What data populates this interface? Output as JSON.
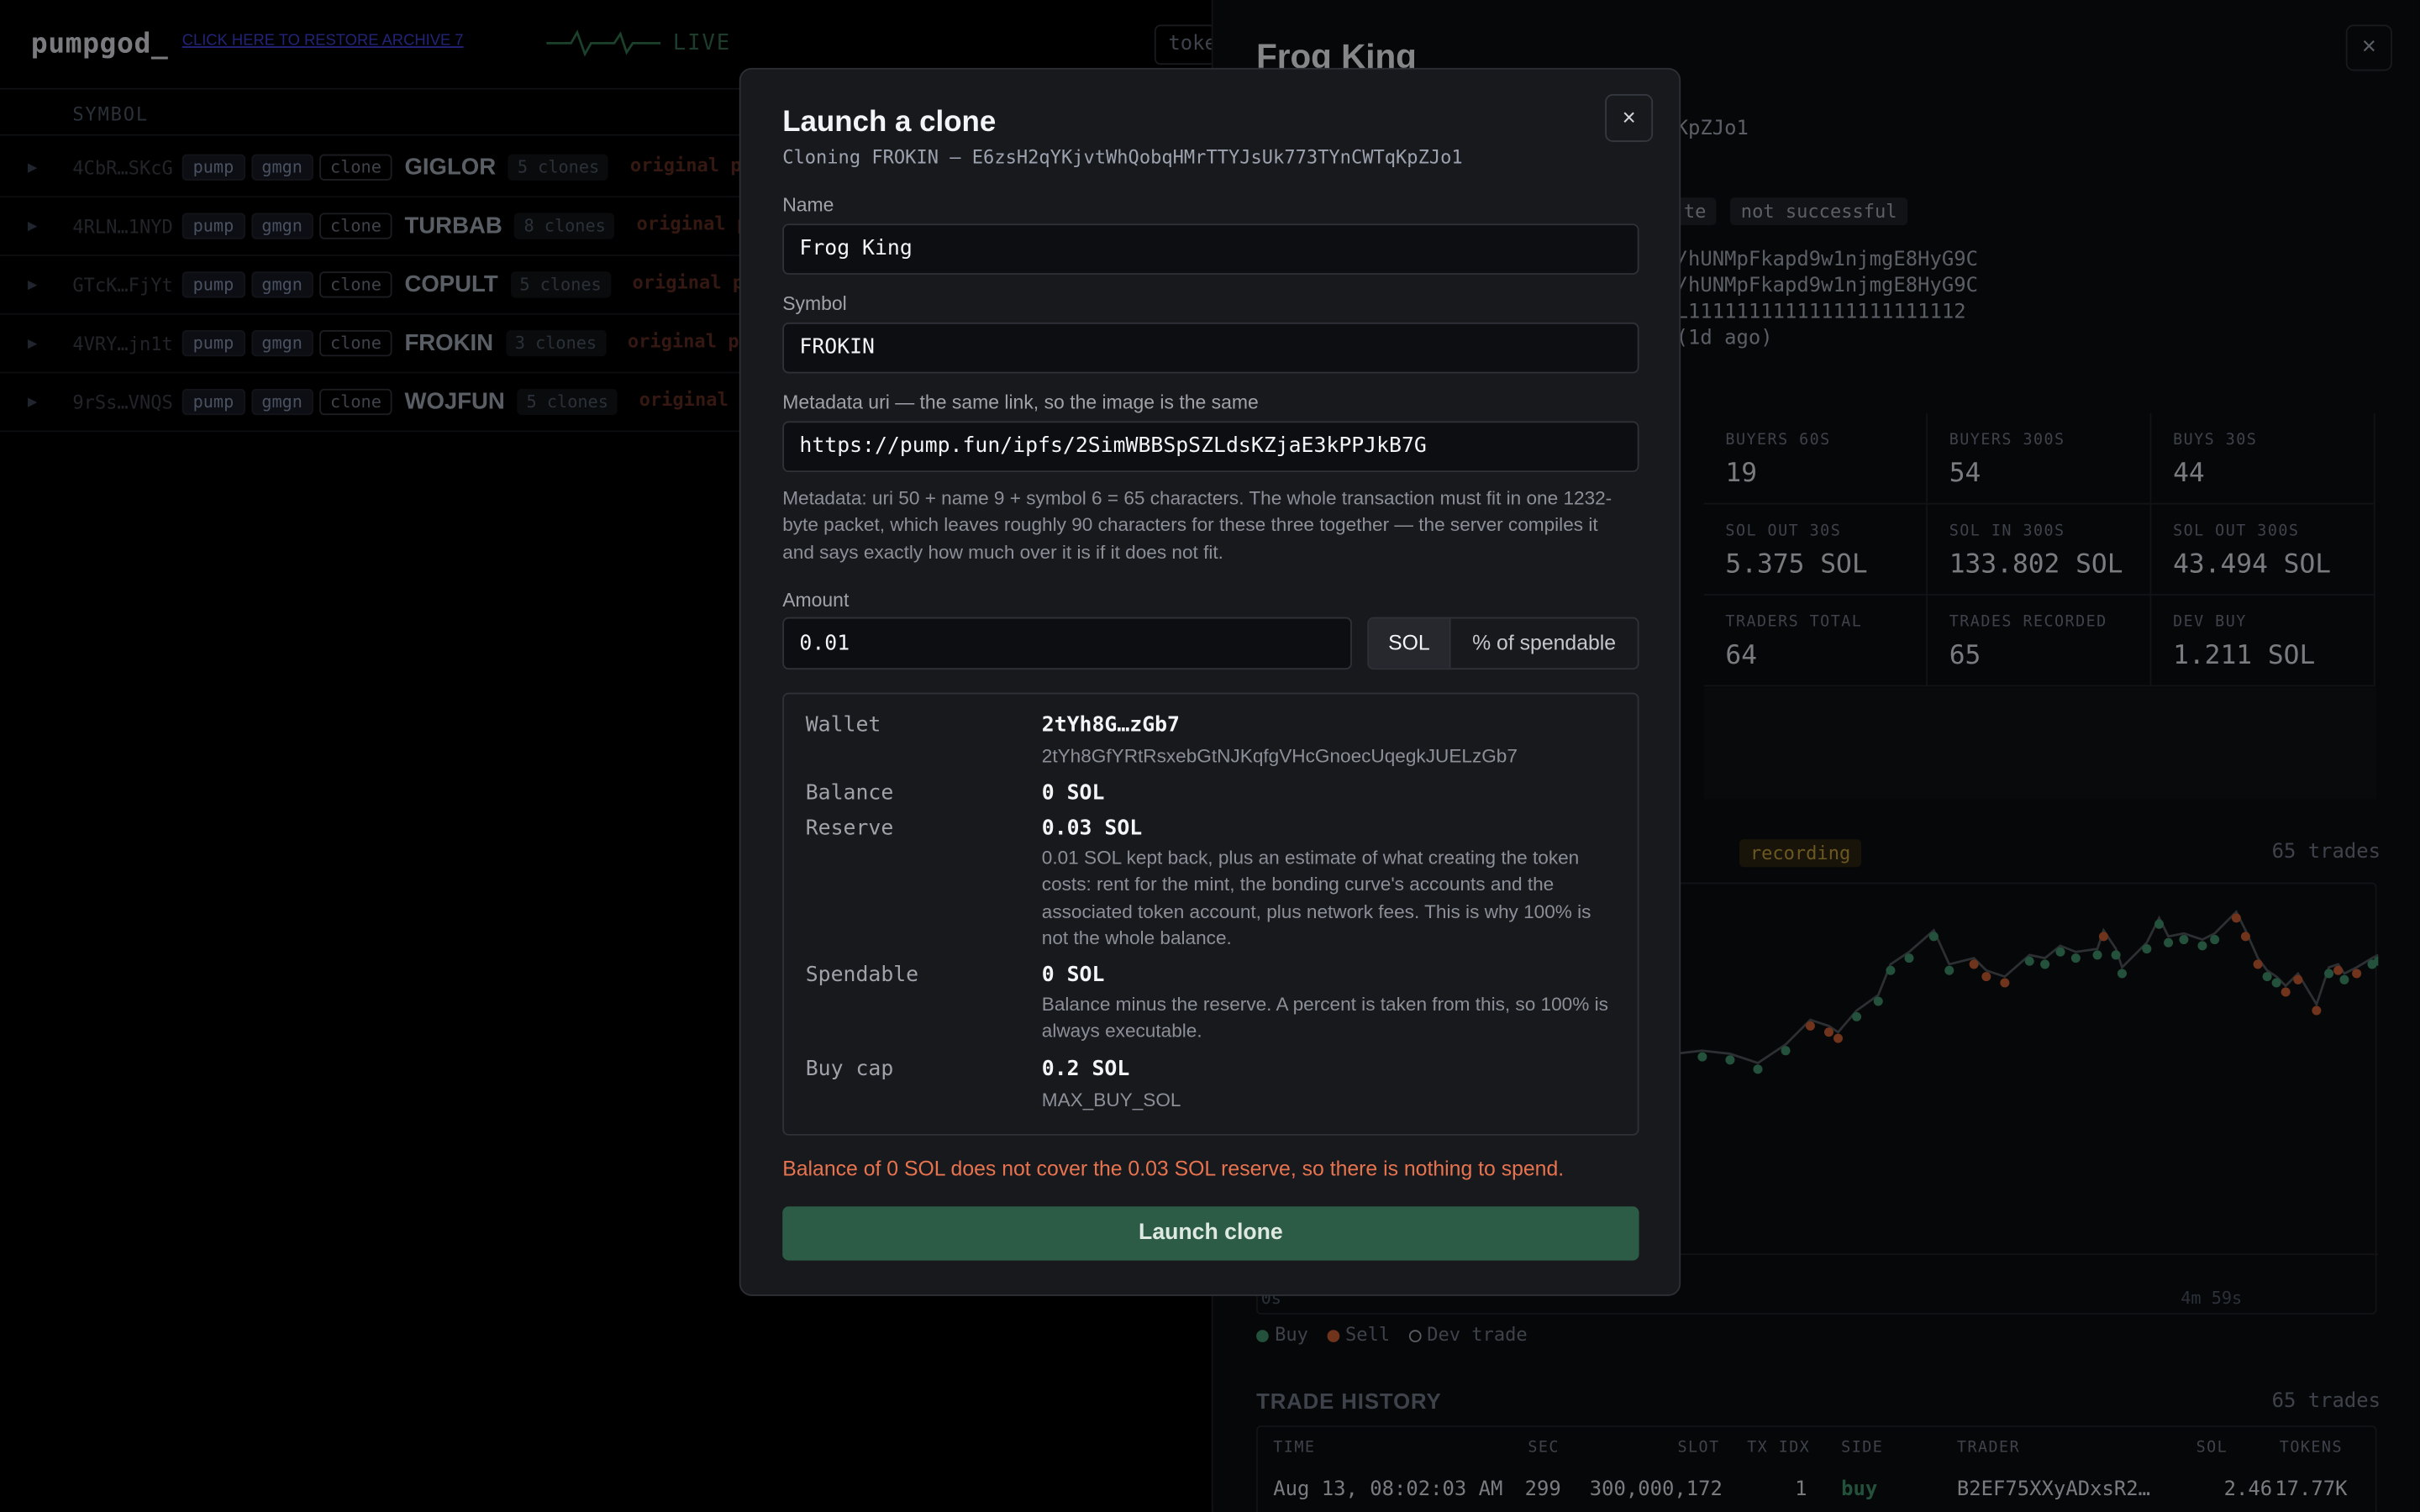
{
  "app": {
    "logo": "pumpgod_",
    "top_link": "CLICK HERE TO RESTORE ARCHIVE 7",
    "live_label": "LIVE",
    "token_search_placeholder": "toke"
  },
  "list": {
    "header_symbol": "SYMBOL",
    "rows": [
      {
        "addr": "4CbR…SKcG",
        "tags": [
          "pump",
          "gmgn",
          "clone"
        ],
        "symbol": "GIGLOR",
        "clones": "5 clones",
        "orig": "original pru"
      },
      {
        "addr": "4RLN…1NYD",
        "tags": [
          "pump",
          "gmgn",
          "clone"
        ],
        "symbol": "TURBAB",
        "clones": "8 clones",
        "orig": "original pru"
      },
      {
        "addr": "GTcK…FjYt",
        "tags": [
          "pump",
          "gmgn",
          "clone"
        ],
        "symbol": "COPULT",
        "clones": "5 clones",
        "orig": "original pru"
      },
      {
        "addr": "4VRY…jn1t",
        "tags": [
          "pump",
          "gmgn",
          "clone"
        ],
        "symbol": "FROKIN",
        "clones": "3 clones",
        "orig": "original pru"
      },
      {
        "addr": "9rSs…VNQS",
        "tags": [
          "pump",
          "gmgn",
          "clone"
        ],
        "symbol": "WOJFUN",
        "clones": "5 clones",
        "orig": "original pru"
      }
    ]
  },
  "detail": {
    "title": "Frog King",
    "mint_tail": "KpZJo1",
    "badge1": "te",
    "badge2": "not successful",
    "addr_line1": "/hUNMpFkapd9w1njmgE8HyG9C",
    "addr_line2": "/hUNMpFkapd9w1njmgE8HyG9C",
    "addr_line3": "L11111111111111111111112",
    "age": "(1d ago)",
    "stats": [
      {
        "label": "BUYERS 60S",
        "value": "19"
      },
      {
        "label": "BUYERS 300S",
        "value": "54"
      },
      {
        "label": "BUYS 30S",
        "value": "44"
      },
      {
        "label": "SOL OUT 30S",
        "value": "5.375 SOL"
      },
      {
        "label": "SOL IN 300S",
        "value": "133.802 SOL"
      },
      {
        "label": "SOL OUT 300S",
        "value": "43.494 SOL"
      },
      {
        "label": "TRADERS TOTAL",
        "value": "64"
      },
      {
        "label": "TRADES RECORDED",
        "value": "65"
      },
      {
        "label": "DEV BUY",
        "value": "1.211 SOL"
      }
    ],
    "recording": "recording",
    "trade_count": "65 trades",
    "axis_start": "0s",
    "axis_end": "4m 59s",
    "legend": {
      "buy": "Buy",
      "sell": "Sell",
      "dev": "Dev trade"
    },
    "colors": {
      "buy": "#3d8c68",
      "sell": "#c2582f",
      "line": "#4d5359"
    },
    "history_title": "TRADE HISTORY",
    "history_count": "65 trades",
    "history_headers": [
      "TIME",
      "SEC",
      "SLOT",
      "TX IDX",
      "SIDE",
      "TRADER",
      "SOL",
      "TOKENS"
    ],
    "history_row": [
      "Aug 13, 08:02:03 AM",
      "299",
      "300,000,172",
      "1",
      "buy",
      "B2EF75XXyADxsR2…",
      "2.46",
      "17.77K"
    ]
  },
  "modal": {
    "title": "Launch a clone",
    "subtitle": "Cloning FROKIN — E6zsH2qYKjvtWhQobqHMrTTYJsUk773TYnCWTqKpZJo1",
    "close": "×",
    "name_label": "Name",
    "name_value": "Frog King",
    "symbol_label": "Symbol",
    "symbol_value": "FROKIN",
    "uri_label": "Metadata uri — the same link, so the image is the same",
    "uri_value": "https://pump.fun/ipfs/2SimWBBSpSZLdsKZjaE3kPPJkB7G",
    "hint": "Metadata: uri 50 + name 9 + symbol 6 = 65 characters. The whole transaction must fit in one 1232-byte packet, which leaves roughly 90 characters for these three together — the server compiles it and says exactly how much over it is if it does not fit.",
    "amount_label": "Amount",
    "amount_value": "0.01",
    "unit_sol": "SOL",
    "unit_pct": "% of spendable",
    "wallet_label": "Wallet",
    "wallet_short": "2tYh8G…zGb7",
    "wallet_full": "2tYh8GfYRtRsxebGtNJKqfgVHcGnoecUqegkJUELzGb7",
    "balance_label": "Balance",
    "balance_value": "0 SOL",
    "reserve_label": "Reserve",
    "reserve_value": "0.03 SOL",
    "reserve_note": "0.01 SOL kept back, plus an estimate of what creating the token costs: rent for the mint, the bonding curve's accounts and the associated token account, plus network fees. This is why 100% is not the whole balance.",
    "spendable_label": "Spendable",
    "spendable_value": "0 SOL",
    "spendable_note": "Balance minus the reserve. A percent is taken from this, so 100% is always executable.",
    "cap_label": "Buy cap",
    "cap_value": "0.2 SOL",
    "cap_note": "MAX_BUY_SOL",
    "error": "Balance of 0 SOL does not cover the 0.03 SOL reserve, so there is nothing to spend.",
    "launch": "Launch clone"
  }
}
